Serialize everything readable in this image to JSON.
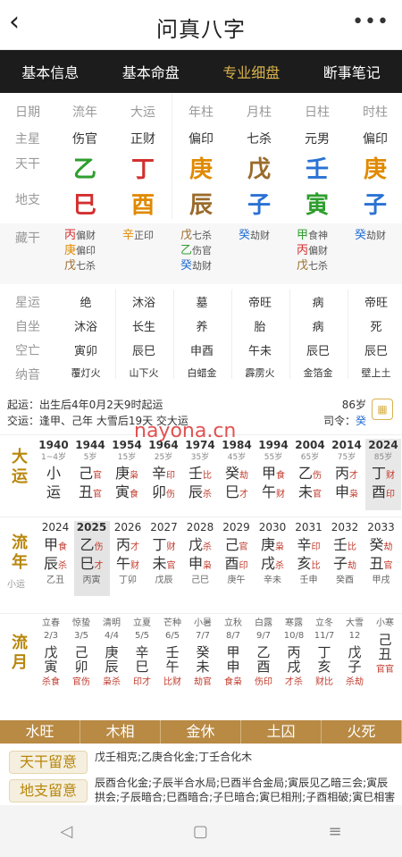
{
  "header": {
    "title": "问真八字",
    "back_icon": "chevron-left-icon",
    "more_icon": "more-dots-icon"
  },
  "tabs": [
    "基本信息",
    "基本命盘",
    "专业细盘",
    "断事笔记"
  ],
  "chart": {
    "labels": [
      "日期",
      "主星",
      "天干",
      "地支"
    ],
    "cols": [
      {
        "date": "流年",
        "star": "伤官",
        "gan": "乙",
        "zhi": "巳",
        "gc": "#2e9e2e",
        "zc": "#d32f2f"
      },
      {
        "date": "大运",
        "star": "正财",
        "gan": "丁",
        "zhi": "酉",
        "gc": "#d32f2f",
        "zc": "#e08a00"
      },
      {
        "date": "年柱",
        "star": "偏印",
        "gan": "庚",
        "zhi": "辰",
        "gc": "#e08a00",
        "zc": "#9a6b2b"
      },
      {
        "date": "月柱",
        "star": "七杀",
        "gan": "戊",
        "zhi": "子",
        "gc": "#9a6b2b",
        "zc": "#2a72d4"
      },
      {
        "date": "日柱",
        "star": "元男",
        "gan": "壬",
        "zhi": "寅",
        "gc": "#2a72d4",
        "zc": "#2e9e2e"
      },
      {
        "date": "时柱",
        "star": "偏印",
        "gan": "庚",
        "zhi": "子",
        "gc": "#e08a00",
        "zc": "#2a72d4"
      }
    ]
  },
  "canggan": {
    "label": "藏干",
    "cols": [
      [
        {
          "g": "丙",
          "s": "偏财",
          "c": "#d32f2f"
        },
        {
          "g": "庚",
          "s": "偏印",
          "c": "#e08a00"
        },
        {
          "g": "戊",
          "s": "七杀",
          "c": "#9a6b2b"
        }
      ],
      [
        {
          "g": "辛",
          "s": "正印",
          "c": "#e08a00"
        }
      ],
      [
        {
          "g": "戊",
          "s": "七杀",
          "c": "#9a6b2b"
        },
        {
          "g": "乙",
          "s": "伤官",
          "c": "#2e9e2e"
        },
        {
          "g": "癸",
          "s": "劫财",
          "c": "#2a72d4"
        }
      ],
      [
        {
          "g": "癸",
          "s": "劫财",
          "c": "#2a72d4"
        }
      ],
      [
        {
          "g": "甲",
          "s": "食神",
          "c": "#2e9e2e"
        },
        {
          "g": "丙",
          "s": "偏财",
          "c": "#d32f2f"
        },
        {
          "g": "戊",
          "s": "七杀",
          "c": "#9a6b2b"
        }
      ],
      [
        {
          "g": "癸",
          "s": "劫财",
          "c": "#2a72d4"
        }
      ]
    ]
  },
  "xingyun": {
    "labels": [
      "星运",
      "自坐",
      "空亡",
      "纳音"
    ],
    "cols": [
      [
        "绝",
        "沐浴",
        "寅卯",
        "覆灯火"
      ],
      [
        "沐浴",
        "长生",
        "辰巳",
        "山下火"
      ],
      [
        "墓",
        "养",
        "申酉",
        "白蜡金"
      ],
      [
        "帝旺",
        "胎",
        "午未",
        "霹雳火"
      ],
      [
        "病",
        "病",
        "辰巳",
        "金箔金"
      ],
      [
        "帝旺",
        "死",
        "辰巳",
        "壁上土"
      ]
    ]
  },
  "info": {
    "qiyun_label": "起运：",
    "qiyun": "出生后4年0月2天9时起运",
    "jiaoyun_label": "交运：",
    "jiaoyun": "逢甲、己年 大雪后19天 交大运",
    "age": "86岁",
    "siling_label": "司令：",
    "siling": "癸",
    "calendar_icon": "calendar-icon"
  },
  "dayun": {
    "title": "大运",
    "items": [
      {
        "y": "1940",
        "a": "1~4岁",
        "g": "小",
        "z": "运",
        "gs": "",
        "zs": ""
      },
      {
        "y": "1944",
        "a": "5岁",
        "g": "己",
        "z": "丑",
        "gs": "官",
        "zs": "官"
      },
      {
        "y": "1954",
        "a": "15岁",
        "g": "庚",
        "z": "寅",
        "gs": "枭",
        "zs": "食"
      },
      {
        "y": "1964",
        "a": "25岁",
        "g": "辛",
        "z": "卯",
        "gs": "印",
        "zs": "伤"
      },
      {
        "y": "1974",
        "a": "35岁",
        "g": "壬",
        "z": "辰",
        "gs": "比",
        "zs": "杀"
      },
      {
        "y": "1984",
        "a": "45岁",
        "g": "癸",
        "z": "巳",
        "gs": "劫",
        "zs": "才"
      },
      {
        "y": "1994",
        "a": "55岁",
        "g": "甲",
        "z": "午",
        "gs": "食",
        "zs": "财"
      },
      {
        "y": "2004",
        "a": "65岁",
        "g": "乙",
        "z": "未",
        "gs": "伤",
        "zs": "官"
      },
      {
        "y": "2014",
        "a": "75岁",
        "g": "丙",
        "z": "申",
        "gs": "才",
        "zs": "枭"
      },
      {
        "y": "2024",
        "a": "85岁",
        "g": "丁",
        "z": "酉",
        "gs": "财",
        "zs": "印"
      }
    ]
  },
  "liunian": {
    "title": "流年",
    "sub": "小运",
    "items": [
      {
        "y": "2024",
        "g": "甲",
        "z": "辰",
        "gs": "食",
        "zs": "杀",
        "x": "乙丑"
      },
      {
        "y": "2025",
        "g": "乙",
        "z": "巳",
        "gs": "伤",
        "zs": "才",
        "x": "丙寅"
      },
      {
        "y": "2026",
        "g": "丙",
        "z": "午",
        "gs": "才",
        "zs": "财",
        "x": "丁卯"
      },
      {
        "y": "2027",
        "g": "丁",
        "z": "未",
        "gs": "财",
        "zs": "官",
        "x": "戊辰"
      },
      {
        "y": "2028",
        "g": "戊",
        "z": "申",
        "gs": "杀",
        "zs": "枭",
        "x": "己巳"
      },
      {
        "y": "2029",
        "g": "己",
        "z": "酉",
        "gs": "官",
        "zs": "印",
        "x": "庚午"
      },
      {
        "y": "2030",
        "g": "庚",
        "z": "戌",
        "gs": "枭",
        "zs": "杀",
        "x": "辛未"
      },
      {
        "y": "2031",
        "g": "辛",
        "z": "亥",
        "gs": "印",
        "zs": "比",
        "x": "壬申"
      },
      {
        "y": "2032",
        "g": "壬",
        "z": "子",
        "gs": "比",
        "zs": "劫",
        "x": "癸酉"
      },
      {
        "y": "2033",
        "g": "癸",
        "z": "丑",
        "gs": "劫",
        "zs": "官",
        "x": "甲戌"
      }
    ]
  },
  "liuyue": {
    "title": "流月",
    "items": [
      {
        "j": "立春",
        "d": "2/3",
        "g": "戊",
        "z": "寅",
        "s": "杀食"
      },
      {
        "j": "惊蛰",
        "d": "3/5",
        "g": "己",
        "z": "卯",
        "s": "官伤"
      },
      {
        "j": "清明",
        "d": "4/4",
        "g": "庚",
        "z": "辰",
        "s": "枭杀"
      },
      {
        "j": "立夏",
        "d": "5/5",
        "g": "辛",
        "z": "巳",
        "s": "印才"
      },
      {
        "j": "芒种",
        "d": "6/5",
        "g": "壬",
        "z": "午",
        "s": "比财"
      },
      {
        "j": "小暑",
        "d": "7/7",
        "g": "癸",
        "z": "未",
        "s": "劫官"
      },
      {
        "j": "立秋",
        "d": "8/7",
        "g": "甲",
        "z": "申",
        "s": "食枭"
      },
      {
        "j": "白露",
        "d": "9/7",
        "g": "乙",
        "z": "酉",
        "s": "伤印"
      },
      {
        "j": "寒露",
        "d": "10/8",
        "g": "丙",
        "z": "戌",
        "s": "才杀"
      },
      {
        "j": "立冬",
        "d": "11/7",
        "g": "丁",
        "z": "亥",
        "s": "财比"
      },
      {
        "j": "大雪",
        "d": "12",
        "g": "戊",
        "z": "子",
        "s": "杀劫"
      },
      {
        "j": "小寒",
        "d": "",
        "g": "己",
        "z": "丑",
        "s": "官官"
      }
    ]
  },
  "wuxing": [
    "水旺",
    "木相",
    "金休",
    "土囚",
    "火死"
  ],
  "notes": {
    "tg_label": "天干留意",
    "tg": "戊壬相克;乙庚合化金;丁壬合化木",
    "dz_label": "地支留意",
    "dz": "辰酉合化金;子辰半合水局;巳酉半合金局;寅辰见乙暗三会;寅辰拱会;子辰暗合;巳酉暗合;子巳暗合;寅巳相刑;子酉相破;寅巳相害"
  },
  "watermark": "nayona.cn",
  "nav": {
    "back": "back-triangle-icon",
    "home": "home-square-icon",
    "menu": "menu-lines-icon"
  }
}
